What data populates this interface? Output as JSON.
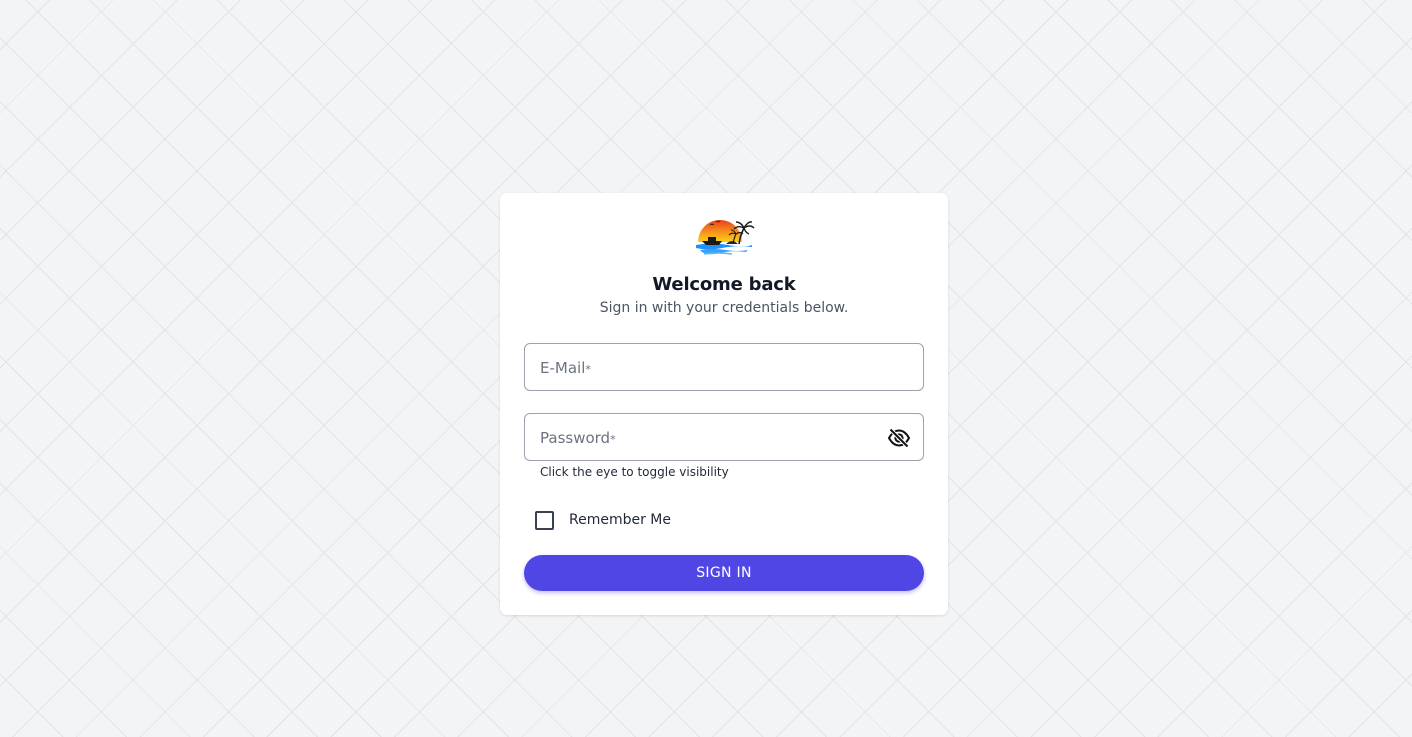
{
  "logo": {
    "icon": "sunset-beach-boat-icon",
    "alt": "logo"
  },
  "login": {
    "title": "Welcome back",
    "subtitle": "Sign in with your credentials below.",
    "email": {
      "label": "E-Mail",
      "required_mark": "*",
      "value": ""
    },
    "password": {
      "label": "Password",
      "required_mark": "*",
      "value": "",
      "toggle_icon": "eye-off-icon",
      "helper": "Click the eye to toggle visibility"
    },
    "remember": {
      "label": "Remember Me",
      "checked": false
    },
    "submit_label": "SIGN IN"
  },
  "colors": {
    "background": "#f3f4f6",
    "card": "#ffffff",
    "accent": "#4f46e5",
    "text_primary": "#111827",
    "text_secondary": "#4b5563"
  }
}
